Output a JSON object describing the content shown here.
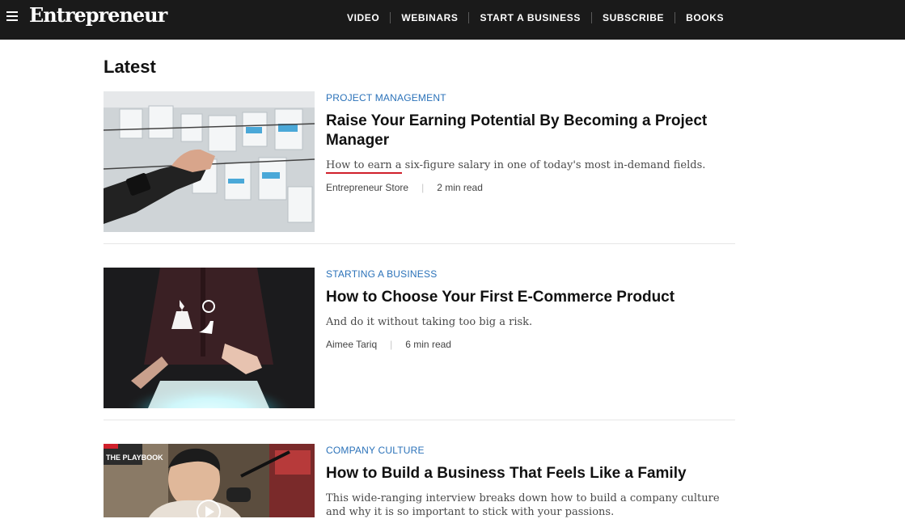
{
  "header": {
    "logo": "Entrepreneur",
    "nav": [
      "VIDEO",
      "WEBINARS",
      "START A BUSINESS",
      "SUBSCRIBE",
      "BOOKS"
    ]
  },
  "section": {
    "title": "Latest"
  },
  "articles": [
    {
      "category": "PROJECT MANAGEMENT",
      "title": "Raise Your Earning Potential By Becoming a Project Manager",
      "dek_underlined": "How to earn a",
      "dek_rest": " six-figure salary in one of today's most in-demand fields.",
      "author": "Entrepreneur Store",
      "read_time": "2 min read"
    },
    {
      "category": "STARTING A BUSINESS",
      "title": "How to Choose Your First E-Commerce Product",
      "dek": "And do it without taking too big a risk.",
      "author": "Aimee Tariq",
      "read_time": "6 min read"
    },
    {
      "category": "COMPANY CULTURE",
      "title": "How to Build a Business That Feels Like a Family",
      "dek": "This wide-ranging interview breaks down how to build a company culture and why it is so important to stick with your passions.",
      "thumb_badge": "THE PLAYBOOK"
    }
  ],
  "colors": {
    "header_bg": "#1a1a1a",
    "category": "#2b72b9",
    "highlight_underline": "#d0202b"
  },
  "icons": [
    "hamburger-menu-icon",
    "play-icon"
  ]
}
